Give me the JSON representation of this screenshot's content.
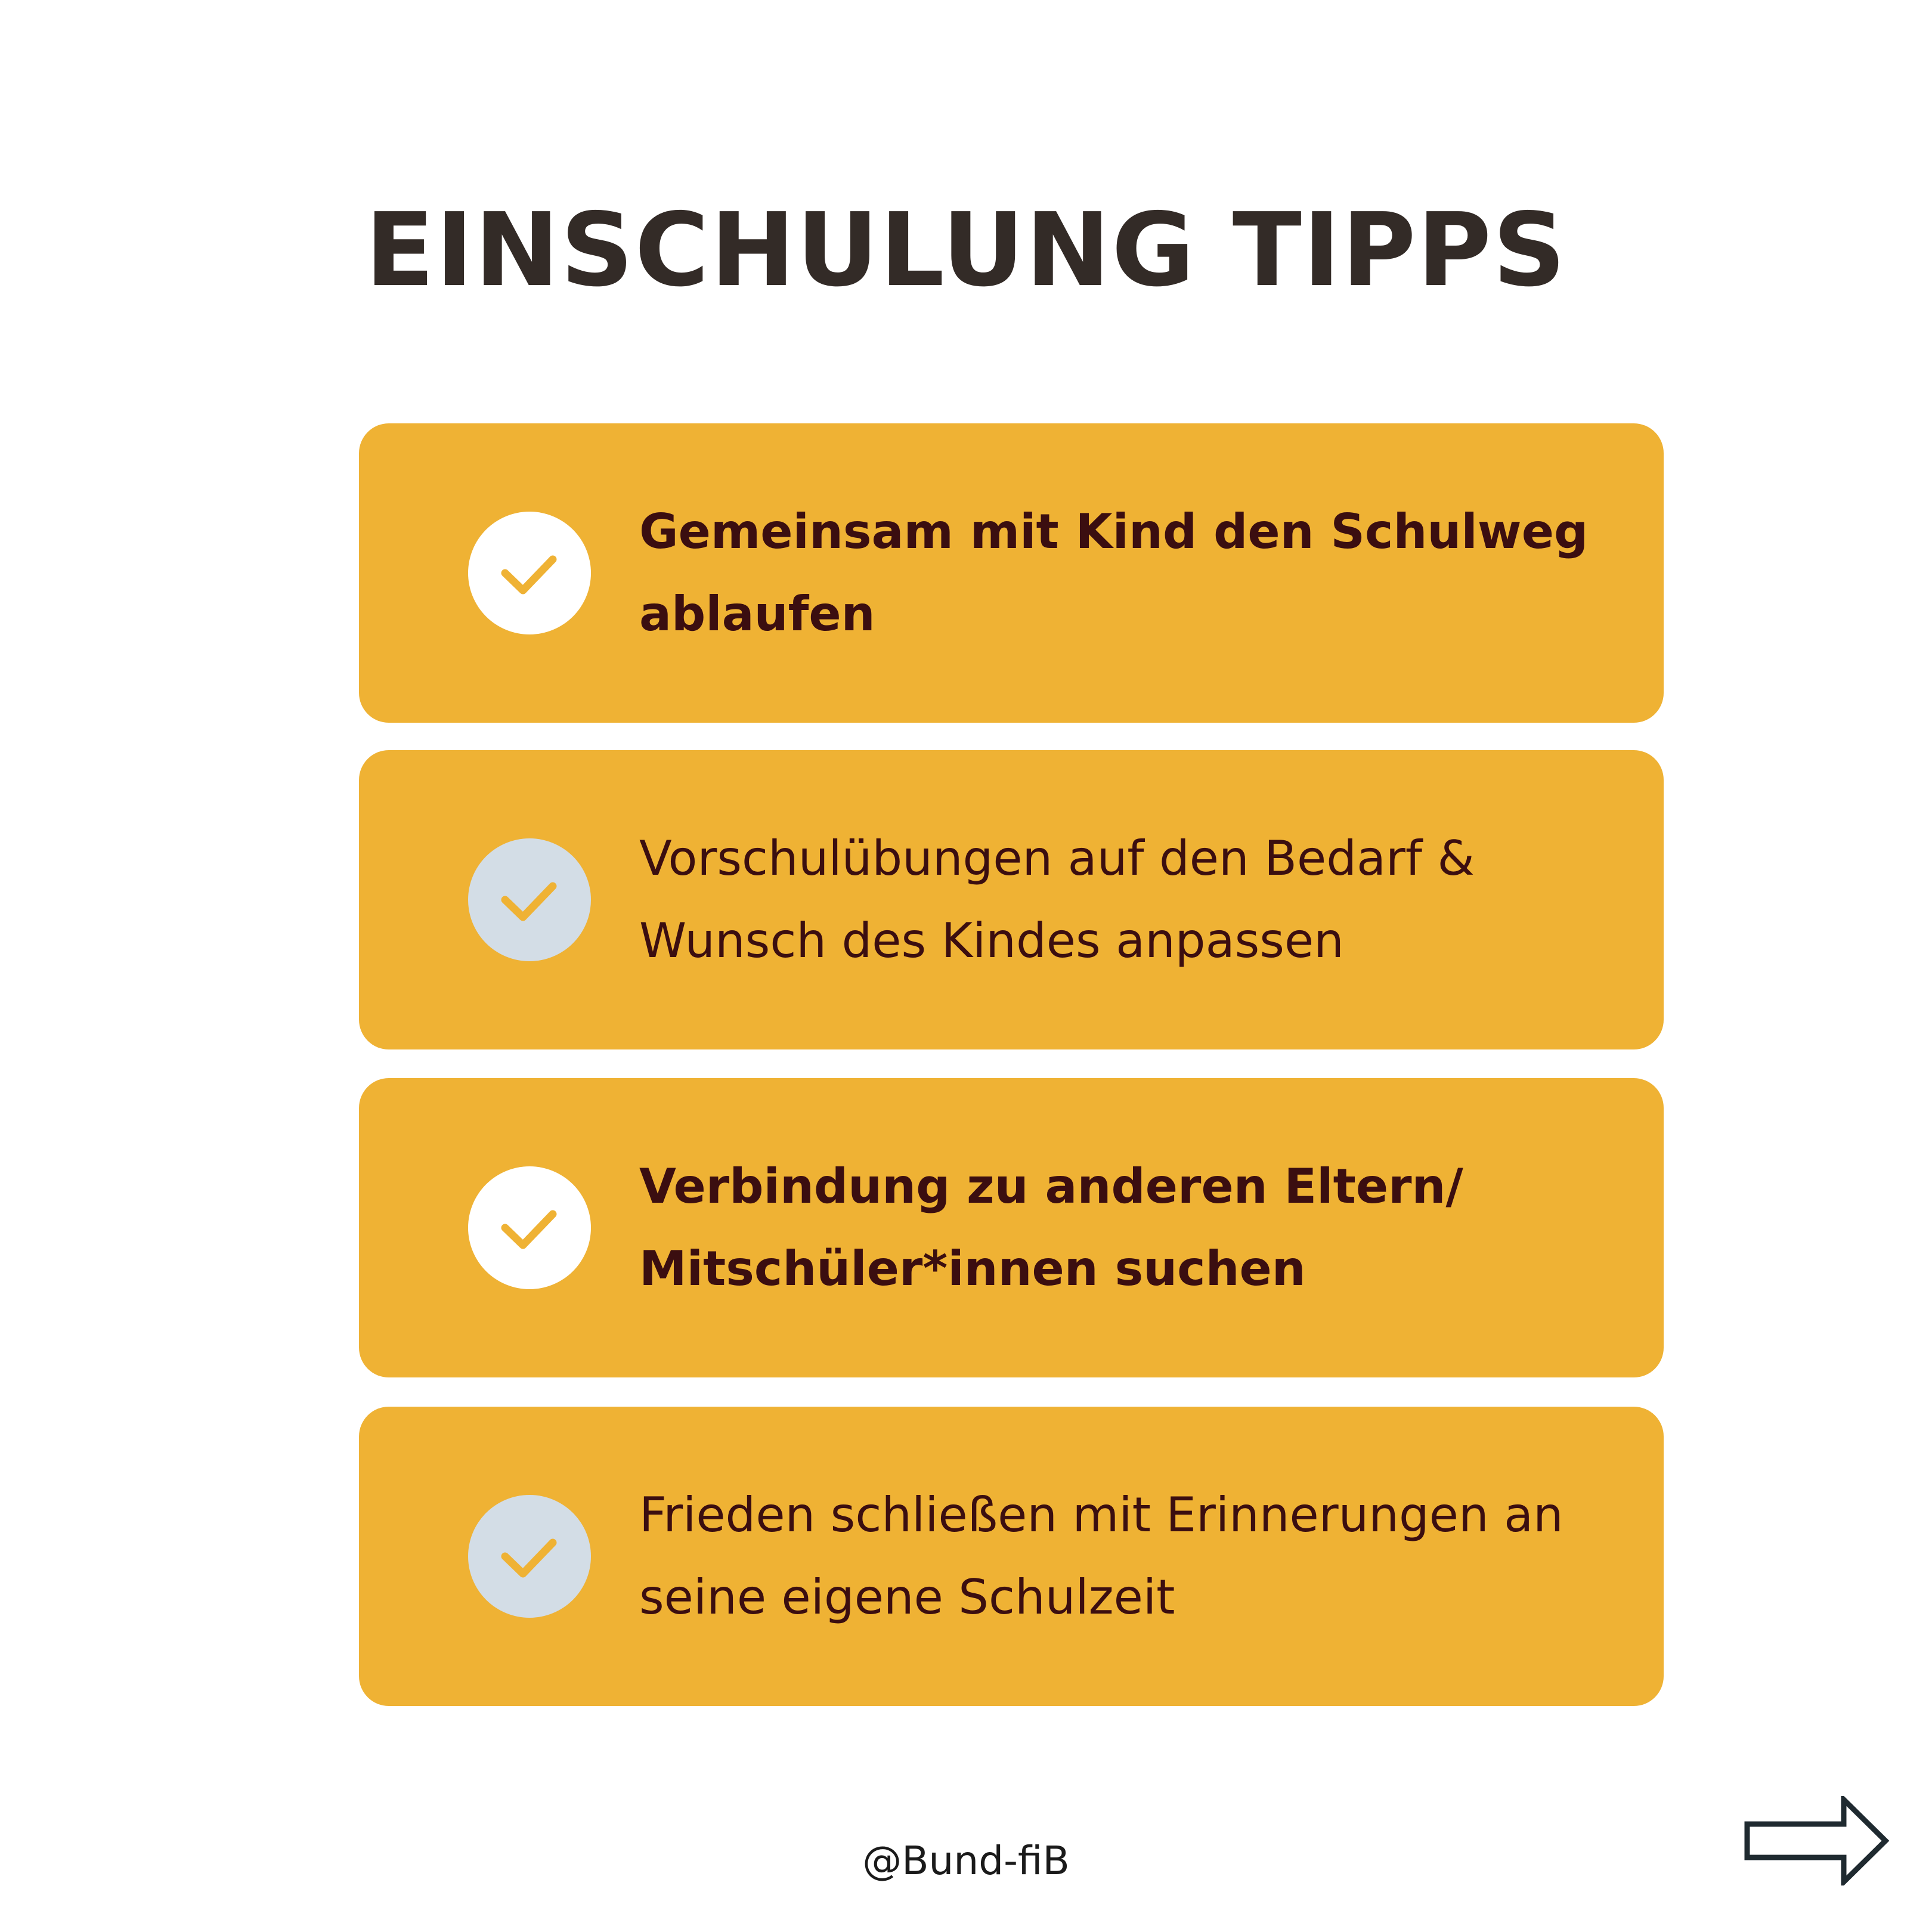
{
  "title": "EINSCHULUNG TIPPS",
  "tips": [
    {
      "text": "Gemeinsam mit Kind den Schulweg ablaufen",
      "style": "bold",
      "check_bg": "white",
      "icon": "check-icon"
    },
    {
      "text": "Vorschulübungen auf den Bedarf & Wunsch des Kindes anpassen",
      "style": "regular",
      "check_bg": "grey",
      "icon": "check-icon"
    },
    {
      "text": "Verbindung zu anderen Eltern/ Mitschüler*innen suchen",
      "style": "bold",
      "check_bg": "white",
      "icon": "check-icon"
    },
    {
      "text": "Frieden schließen mit Erinnerungen an seine eigene Schulzeit",
      "style": "regular",
      "check_bg": "grey",
      "icon": "check-icon"
    }
  ],
  "footer": {
    "handle": "@Bund-fiB",
    "next_icon": "arrow-right-icon"
  },
  "colors": {
    "card": "#efb234",
    "check": "#efb234",
    "text": "#3b0e10",
    "title": "#332b27",
    "circle_white": "#ffffff",
    "circle_grey": "#d3dde6"
  }
}
